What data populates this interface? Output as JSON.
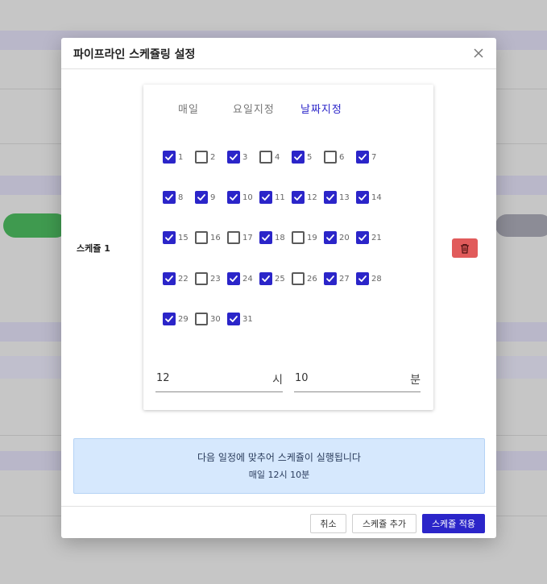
{
  "modal": {
    "title": "파이프라인 스케쥴링 설정",
    "close_icon": "×"
  },
  "schedule": {
    "label": "스케쥴 1",
    "tabs": [
      {
        "label": "매일",
        "active": false
      },
      {
        "label": "요일지정",
        "active": false
      },
      {
        "label": "날짜지정",
        "active": true
      }
    ],
    "days": [
      {
        "n": "1",
        "checked": true
      },
      {
        "n": "2",
        "checked": false
      },
      {
        "n": "3",
        "checked": true
      },
      {
        "n": "4",
        "checked": false
      },
      {
        "n": "5",
        "checked": true
      },
      {
        "n": "6",
        "checked": false
      },
      {
        "n": "7",
        "checked": true
      },
      {
        "n": "8",
        "checked": true
      },
      {
        "n": "9",
        "checked": true
      },
      {
        "n": "10",
        "checked": true
      },
      {
        "n": "11",
        "checked": true
      },
      {
        "n": "12",
        "checked": true
      },
      {
        "n": "13",
        "checked": true
      },
      {
        "n": "14",
        "checked": true
      },
      {
        "n": "15",
        "checked": true
      },
      {
        "n": "16",
        "checked": false
      },
      {
        "n": "17",
        "checked": false
      },
      {
        "n": "18",
        "checked": true
      },
      {
        "n": "19",
        "checked": false
      },
      {
        "n": "20",
        "checked": true
      },
      {
        "n": "21",
        "checked": true
      },
      {
        "n": "22",
        "checked": true
      },
      {
        "n": "23",
        "checked": false
      },
      {
        "n": "24",
        "checked": true
      },
      {
        "n": "25",
        "checked": true
      },
      {
        "n": "26",
        "checked": false
      },
      {
        "n": "27",
        "checked": true
      },
      {
        "n": "28",
        "checked": true
      },
      {
        "n": "29",
        "checked": true
      },
      {
        "n": "30",
        "checked": false
      },
      {
        "n": "31",
        "checked": true
      }
    ],
    "hour": {
      "value": "12",
      "unit": "시"
    },
    "minute": {
      "value": "10",
      "unit": "분"
    }
  },
  "info": {
    "message": "다음 일정에 맞추어 스케쥴이 실행됩니다",
    "summary": "매일 12시 10분"
  },
  "footer": {
    "cancel_label": "취소",
    "add_label": "스케쥴 추가",
    "apply_label": "스케쥴 적용"
  },
  "colors": {
    "accent": "#2b25c9",
    "danger": "#e15b5b",
    "info_bg": "#d6e8fd"
  },
  "icons": {
    "close": "close-icon",
    "check": "check-icon",
    "delete": "trash-icon"
  }
}
